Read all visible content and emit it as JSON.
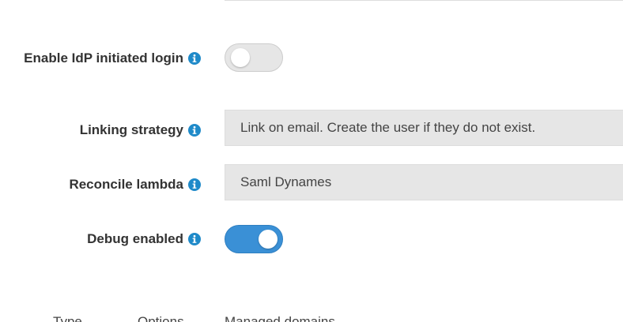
{
  "form": {
    "idp_login": {
      "label": "Enable IdP initiated login",
      "enabled": false
    },
    "linking_strategy": {
      "label": "Linking strategy",
      "value": "Link on email. Create the user if they do not exist."
    },
    "reconcile_lambda": {
      "label": "Reconcile lambda",
      "value": "Saml Dynames"
    },
    "debug": {
      "label": "Debug enabled",
      "enabled": true
    }
  },
  "footer_table": {
    "columns": [
      "Type",
      "Options",
      "Managed domains"
    ]
  },
  "colors": {
    "accent": "#3a90d6",
    "info_icon": "#1f8ac9",
    "toggle_off": "#e6e6e6",
    "select_bg": "#e6e6e6",
    "label_text": "#333333"
  },
  "icons": {
    "info": "info-circle-icon"
  }
}
